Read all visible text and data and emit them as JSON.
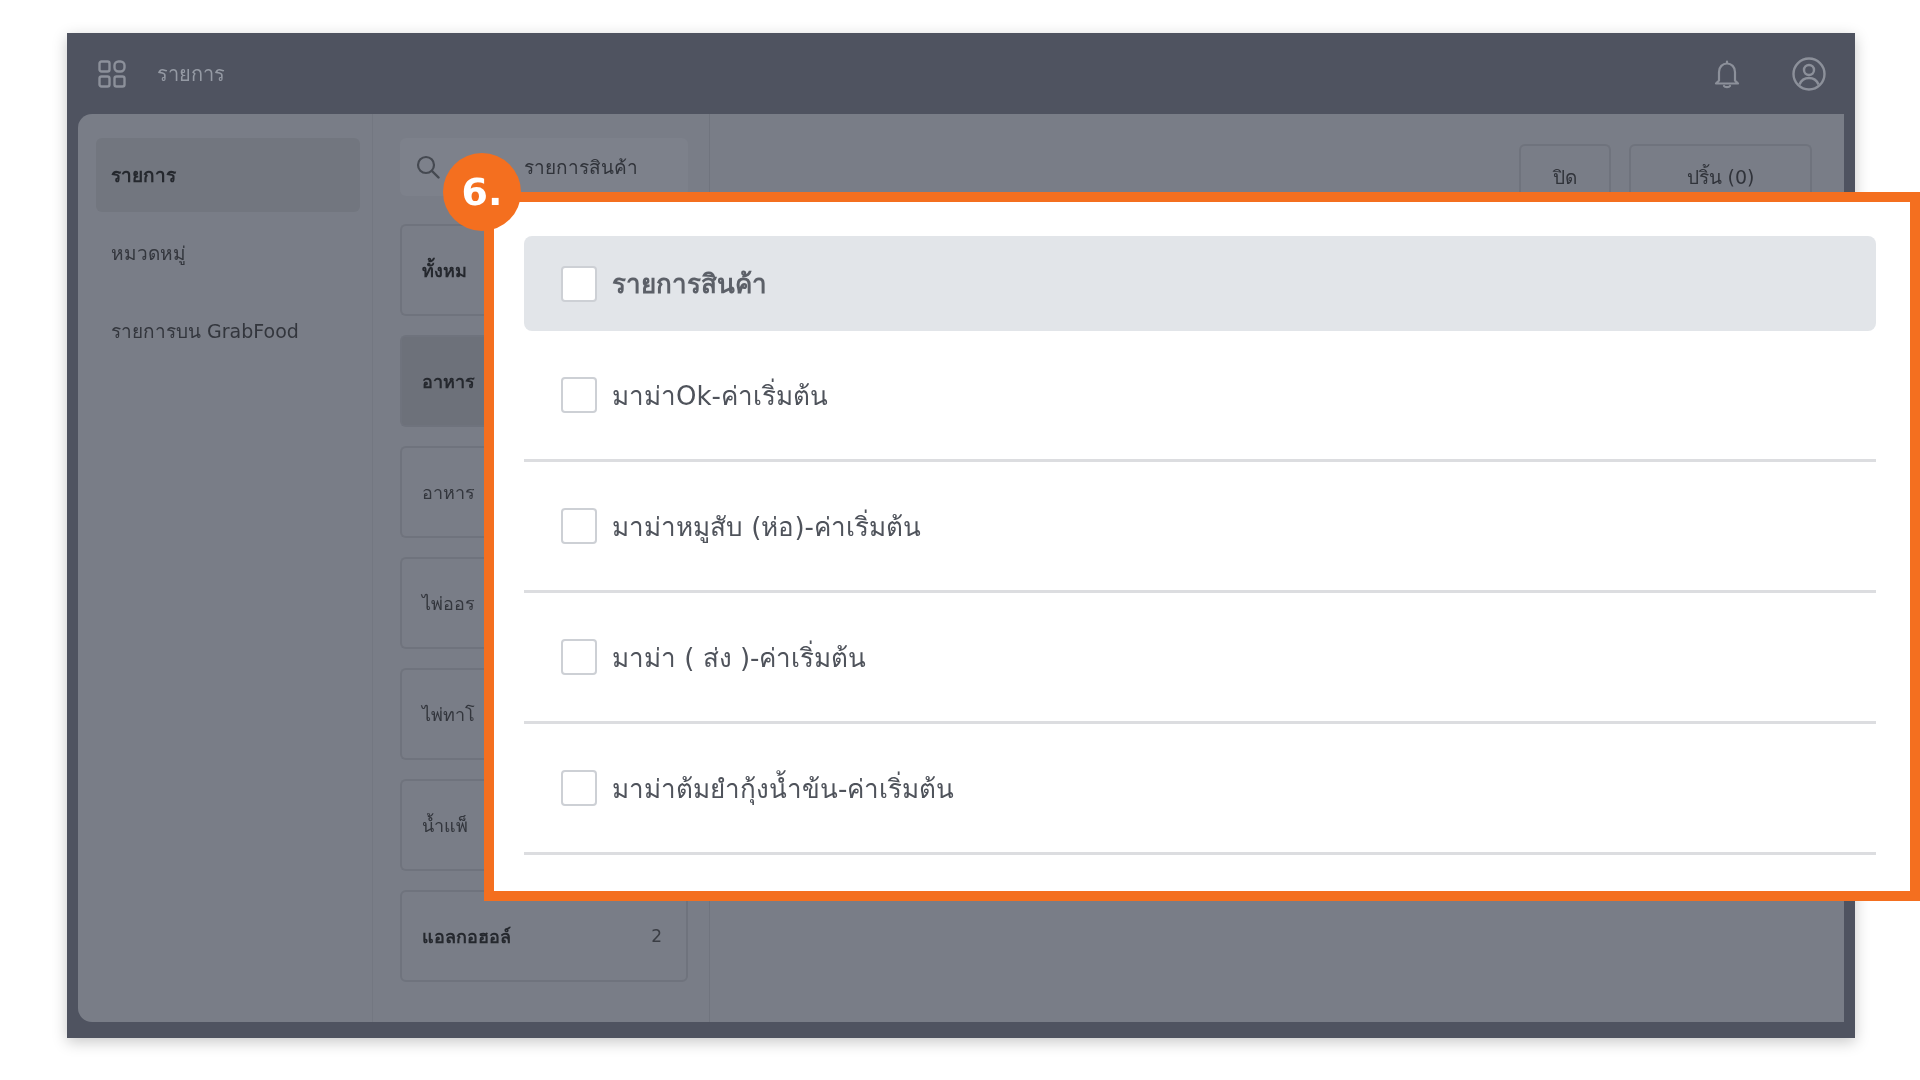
{
  "app_bar": {
    "title": "รายการ"
  },
  "sidebar": {
    "items": [
      {
        "label": "รายการ",
        "selected": true
      },
      {
        "label": "หมวดหมู่",
        "selected": false
      },
      {
        "label": "รายการบน GrabFood",
        "selected": false
      }
    ]
  },
  "search": {
    "placeholder": "รายการสินค้า"
  },
  "categories": [
    {
      "label": "ทั้งหม",
      "selected": false,
      "disabled": false
    },
    {
      "label": "อาหาร",
      "selected": true,
      "disabled": false
    },
    {
      "label": "อาหาร",
      "selected": false,
      "disabled": true
    },
    {
      "label": "ไพ่ออร",
      "selected": false,
      "disabled": true
    },
    {
      "label": "ไพ่ทาโ",
      "selected": false,
      "disabled": true
    },
    {
      "label": "น้ำแพ็",
      "selected": false,
      "disabled": true
    },
    {
      "label": "แอลกอฮอล์",
      "count": "2",
      "selected": false,
      "disabled": false
    }
  ],
  "actions": [
    {
      "label": "ปิด"
    },
    {
      "label": "ปริ้น (0)"
    }
  ],
  "popup": {
    "badge": "6.",
    "header": {
      "label": "รายการสินค้า",
      "checked": false
    },
    "items": [
      {
        "label": "มาม่าOk-ค่าเริ่มต้น",
        "checked": false
      },
      {
        "label": "มาม่าหมูสับ (ห่อ)-ค่าเริ่มต้น",
        "checked": false
      },
      {
        "label": "มาม่า ( ส่ง )-ค่าเริ่มต้น",
        "checked": false
      },
      {
        "label": "มาม่าต้มยำกุ้งน้ำข้น-ค่าเริ่มต้น",
        "checked": false
      }
    ]
  }
}
